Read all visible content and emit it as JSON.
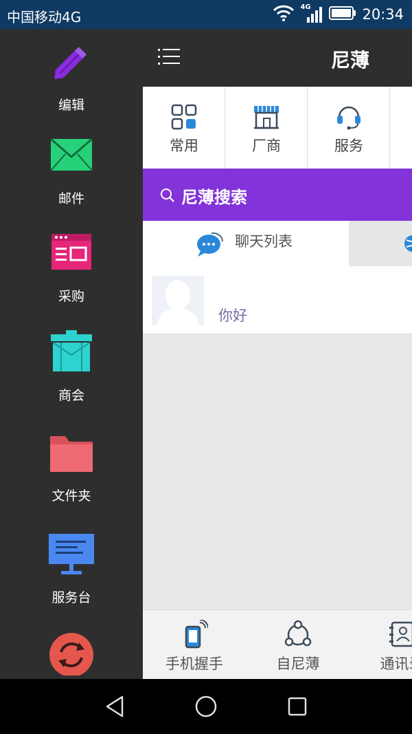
{
  "status_bar": {
    "carrier": "中国移动4G",
    "network_badge": "4G",
    "time": "20:34"
  },
  "drawer": {
    "items": [
      {
        "label": "编辑",
        "icon": "pencil-icon",
        "color": "#8a2be2"
      },
      {
        "label": "邮件",
        "icon": "mail-icon",
        "color": "#27d17a"
      },
      {
        "label": "采购",
        "icon": "purchase-icon",
        "color": "#e5267a"
      },
      {
        "label": "商会",
        "icon": "chamber-icon",
        "color": "#2ed3cf"
      },
      {
        "label": "文件夹",
        "icon": "folder-icon",
        "color": "#ef6a73"
      },
      {
        "label": "服务台",
        "icon": "service-desk-icon",
        "color": "#4a88f0"
      },
      {
        "label": "",
        "icon": "sync-icon",
        "color": "#e5574d"
      }
    ]
  },
  "header": {
    "title": "尼薄",
    "menu_icon": "list-menu-icon"
  },
  "quick_grid": {
    "items": [
      {
        "label": "常用",
        "icon": "grid-icon"
      },
      {
        "label": "厂商",
        "icon": "storefront-icon"
      },
      {
        "label": "服务",
        "icon": "headset-icon"
      }
    ]
  },
  "search": {
    "label": "尼薄搜索",
    "color": "#8233d9"
  },
  "tabs": {
    "active": "聊天列表"
  },
  "chat_list": [
    {
      "message": "你好",
      "avatar": "default-avatar"
    }
  ],
  "bottom_nav": {
    "items": [
      {
        "label": "手机握手",
        "icon": "phone-handshake-icon"
      },
      {
        "label": "自尼薄",
        "icon": "share-nodes-icon"
      },
      {
        "label": "通讯录",
        "icon": "contacts-icon"
      }
    ]
  }
}
